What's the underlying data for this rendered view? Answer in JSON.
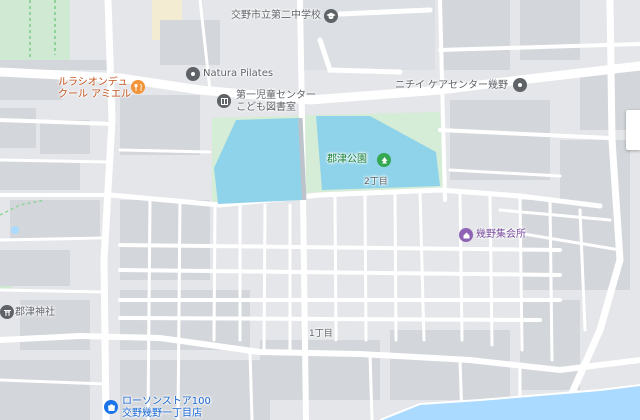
{
  "map": {
    "labels": {
      "school": "交野市立第二中学校",
      "natura": "Natura Pilates",
      "restaurant_line1": "ルラシオンデュ",
      "restaurant_line2": "クール アミエル",
      "library_line1": "第一児童センター",
      "library_line2": "こども図書室",
      "care": "ニチイ ケアセンター幾野",
      "park": "郡津公園",
      "chome2": "2丁目",
      "hall": "幾野集会所",
      "shrine": "郡津神社",
      "chome1": "1丁目",
      "lawson_line1": "ローソンストア100",
      "lawson_line2": "交野幾野一丁目店"
    },
    "icons": {
      "school": "school-icon",
      "natura": "place-icon",
      "restaurant": "restaurant-icon",
      "library": "library-icon",
      "care": "place-icon",
      "park": "park-icon",
      "hall": "community-hall-icon",
      "shrine": "shrine-icon",
      "lawson": "convenience-store-icon"
    },
    "colors": {
      "land": "#e5e7ea",
      "road": "#ffffff",
      "water": "#aadaff",
      "pond": "#8fd3ea",
      "park": "#cdeccf",
      "restaurant": "#f29437",
      "landmark": "#5f6368",
      "green_pin": "#34a853",
      "purple_pin": "#8e63b5",
      "blue_pin": "#1a73e8"
    }
  }
}
